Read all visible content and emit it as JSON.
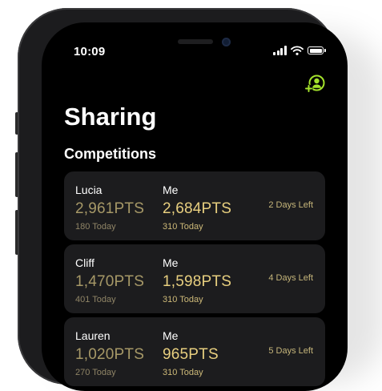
{
  "status_bar": {
    "time": "10:09"
  },
  "header": {
    "title": "Sharing",
    "add_friend_icon": "person-add-icon"
  },
  "competitions": {
    "heading": "Competitions",
    "items": [
      {
        "opponent": "Lucia",
        "opponent_points": "2,961PTS",
        "opponent_today": "180 Today",
        "me": "Me",
        "me_points": "2,684PTS",
        "me_today": "310 Today",
        "days_left": "2 Days Left"
      },
      {
        "opponent": "Cliff",
        "opponent_points": "1,470PTS",
        "opponent_today": "401 Today",
        "me": "Me",
        "me_points": "1,598PTS",
        "me_today": "310 Today",
        "days_left": "4 Days Left"
      },
      {
        "opponent": "Lauren",
        "opponent_points": "1,020PTS",
        "opponent_today": "270 Today",
        "me": "Me",
        "me_points": "965PTS",
        "me_today": "310 Today",
        "days_left": "5 Days Left"
      }
    ]
  },
  "colors": {
    "accent": "#a4e22b",
    "opponent_points": "#a69867",
    "me_points": "#e8cf7f",
    "card_background": "#1c1c1e"
  }
}
